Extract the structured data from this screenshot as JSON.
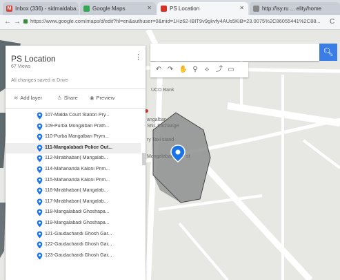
{
  "browser": {
    "tabs": [
      {
        "title": "Inbox (336) - sidmaldaba...",
        "fav": "M",
        "fav_color": "#d44638"
      },
      {
        "title": "Google Maps",
        "fav": "",
        "fav_color": "#34a853"
      },
      {
        "title": "PS Location",
        "fav": "",
        "fav_color": "#d93025"
      },
      {
        "title": "http://isy.ru ... elity/home",
        "fav": "",
        "fav_color": "#888888"
      }
    ],
    "url": "https://www.google.com/maps/d/edit?hl=en&authuser=0&mid=1Hz62-IBIT9v9gkvfy4AUs5KiB=23.0075%2C86055441%2C88..."
  },
  "panel": {
    "title": "PS Location",
    "views": "67 Views",
    "saved_status": "All changes saved in Drive",
    "actions": {
      "add_layer": "Add layer",
      "share": "Share",
      "preview": "Preview"
    },
    "items": [
      "107-Malda Court Station Pry...",
      "109-Purba Mongalbari Prath...",
      "110-Purba Mangalbari Prym...",
      "111-Mangalabadi Police Out...",
      "112-Mirabhaban( Mangalab...",
      "114-Mahananda Kaloni Prim...",
      "115-Mahananda Kaloni Prim...",
      "116-Mirabhaban( Mangalab...",
      "117-Mirabhaban( Mangalab...",
      "118-Mangalabadi Ghoshapa...",
      "119-Mangalabadi Ghoshapa...",
      "121-Gaudachandi Ghosh Gar...",
      "122-Gaudachandi Ghosh Gar...",
      "123-Gaudachandi Ghosh Gar..."
    ],
    "selected_index": 3
  },
  "map": {
    "labels": {
      "uco_bank": "UCO Bank",
      "mangalban": "angalban",
      "exchange": "SNL Exchange",
      "taxi_stand": "ry Taxi stand",
      "mangalabadi": "Mangalabadi",
      "post": "st"
    },
    "colors": {
      "accent": "#3b7de6",
      "polygon": "#777777",
      "pin": "#1a73e8"
    }
  }
}
